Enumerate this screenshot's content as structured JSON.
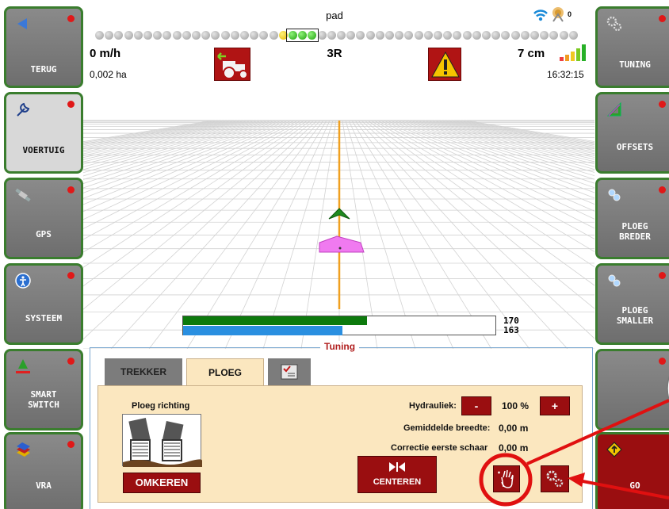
{
  "left_buttons": [
    {
      "label": "TERUG",
      "icon": "back-arrow-icon"
    },
    {
      "label": "VOERTUIG",
      "icon": "wrench-icon"
    },
    {
      "label": "GPS",
      "icon": "satellite-icon"
    },
    {
      "label": "SYSTEEM",
      "icon": "info-circle-icon"
    },
    {
      "label": "SMART\nSWITCH",
      "icon": "smart-switch-icon"
    },
    {
      "label": "VRA",
      "icon": "layers-icon"
    }
  ],
  "right_buttons": [
    {
      "label": "TUNING",
      "icon": "gears-icon"
    },
    {
      "label": "OFFSETS",
      "icon": "ruler-triangle-icon"
    },
    {
      "label": "PLOEG\nBREDER",
      "icon": "plough-wider-icon"
    },
    {
      "label": "PLOEG\nSMALLER",
      "icon": "plough-narrower-icon"
    },
    {
      "label": "",
      "icon": ""
    },
    {
      "label": "GO",
      "icon": "road-sign-icon"
    }
  ],
  "header": {
    "track_label": "pad",
    "speed": "0 m/h",
    "area": "0,002 ha",
    "track_name": "3R",
    "accuracy": "7 cm",
    "time": "16:32:15",
    "satellites": "0"
  },
  "lightbar": {
    "total": 50,
    "yellow": [
      19
    ],
    "green": [
      20,
      21,
      22
    ],
    "box_indices": [
      20,
      22
    ]
  },
  "bar": {
    "value_top": "170",
    "value_bottom": "163",
    "green_fraction": 0.59,
    "blue_fraction": 0.51
  },
  "tuning": {
    "title": "Tuning",
    "tabs": [
      "TREKKER",
      "PLOEG"
    ],
    "active_tab": "PLOEG",
    "ploeg_richting_label": "Ploeg richting",
    "omkeren_label": "OMKEREN",
    "hydrauliek_label": "Hydrauliek:",
    "hydrauliek_minus": "-",
    "hydrauliek_value": "100 %",
    "hydrauliek_plus": "+",
    "gemiddelde_label": "Gemiddelde breedte:",
    "gemiddelde_value": "0,00 m",
    "correctie_label": "Correctie eerste schaar",
    "correctie_value": "0,00 m",
    "centeren_label": "CENTEREN"
  },
  "colors": {
    "button_border": "#3a7d2e",
    "button_gray": "#7a7a7a",
    "accent_red": "#9a0e10",
    "guide_line": "#f0a020",
    "bar_green": "#0d7a0d",
    "bar_blue": "#2a8fe0",
    "annotation_red": "#e01010"
  }
}
